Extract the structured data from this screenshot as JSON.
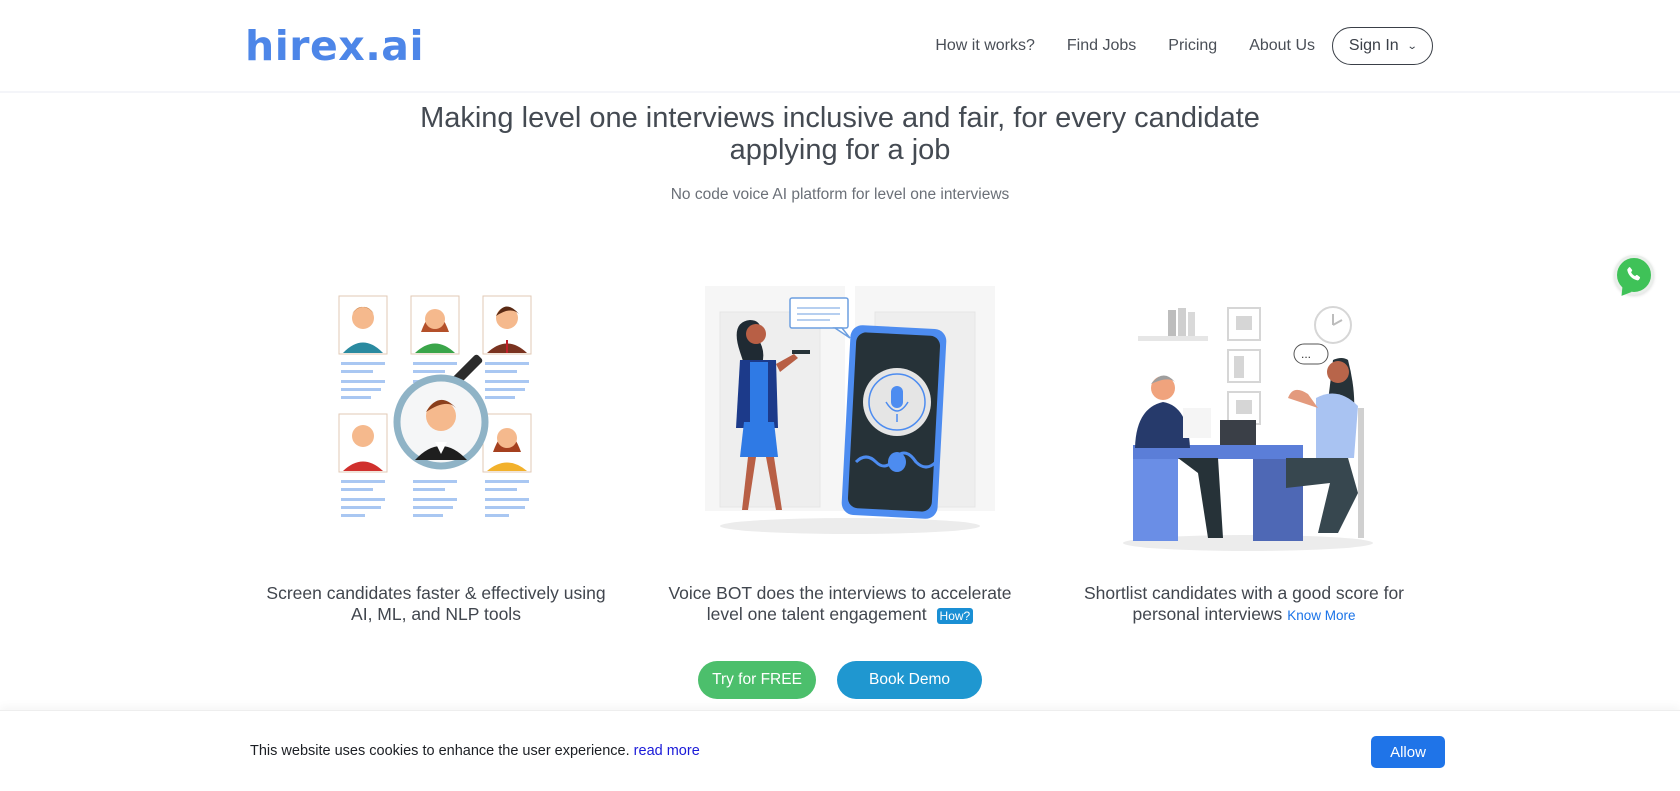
{
  "header": {
    "logo": "hirex.ai",
    "brand_color": "#4d86e8",
    "nav": [
      {
        "label": "How it works?"
      },
      {
        "label": "Find Jobs"
      },
      {
        "label": "Pricing"
      },
      {
        "label": "About Us"
      }
    ],
    "signin_label": "Sign In",
    "signin_icon": "chevron-down-icon"
  },
  "hero": {
    "title_line1": "Making level one interviews inclusive and fair, for every candidate",
    "title_line2": "applying for a job",
    "subtitle": "No code voice AI platform for level one interviews"
  },
  "floating": {
    "whatsapp_icon": "whatsapp-icon",
    "color": "#3fc258"
  },
  "features": [
    {
      "illustration": "candidate-search-illustration",
      "caption_line1": "Screen candidates faster & effectively using",
      "caption_line2": "AI, ML, and NLP tools"
    },
    {
      "illustration": "voice-bot-illustration",
      "caption_line1": "Voice BOT does the interviews to accelerate",
      "caption_line2": "level one talent engagement",
      "link": "How?"
    },
    {
      "illustration": "interview-illustration",
      "caption_line1": "Shortlist candidates with a good score for",
      "caption_line2": "personal interviews",
      "link": "Know More"
    }
  ],
  "cta": {
    "try_label": "Try for FREE",
    "try_color": "#4cbf6c",
    "demo_label": "Book Demo",
    "demo_color": "#1f97d0"
  },
  "cookie": {
    "text": "This website uses cookies to enhance the user experience.",
    "link": "read more",
    "allow_label": "Allow",
    "allow_color": "#1f74e8"
  }
}
